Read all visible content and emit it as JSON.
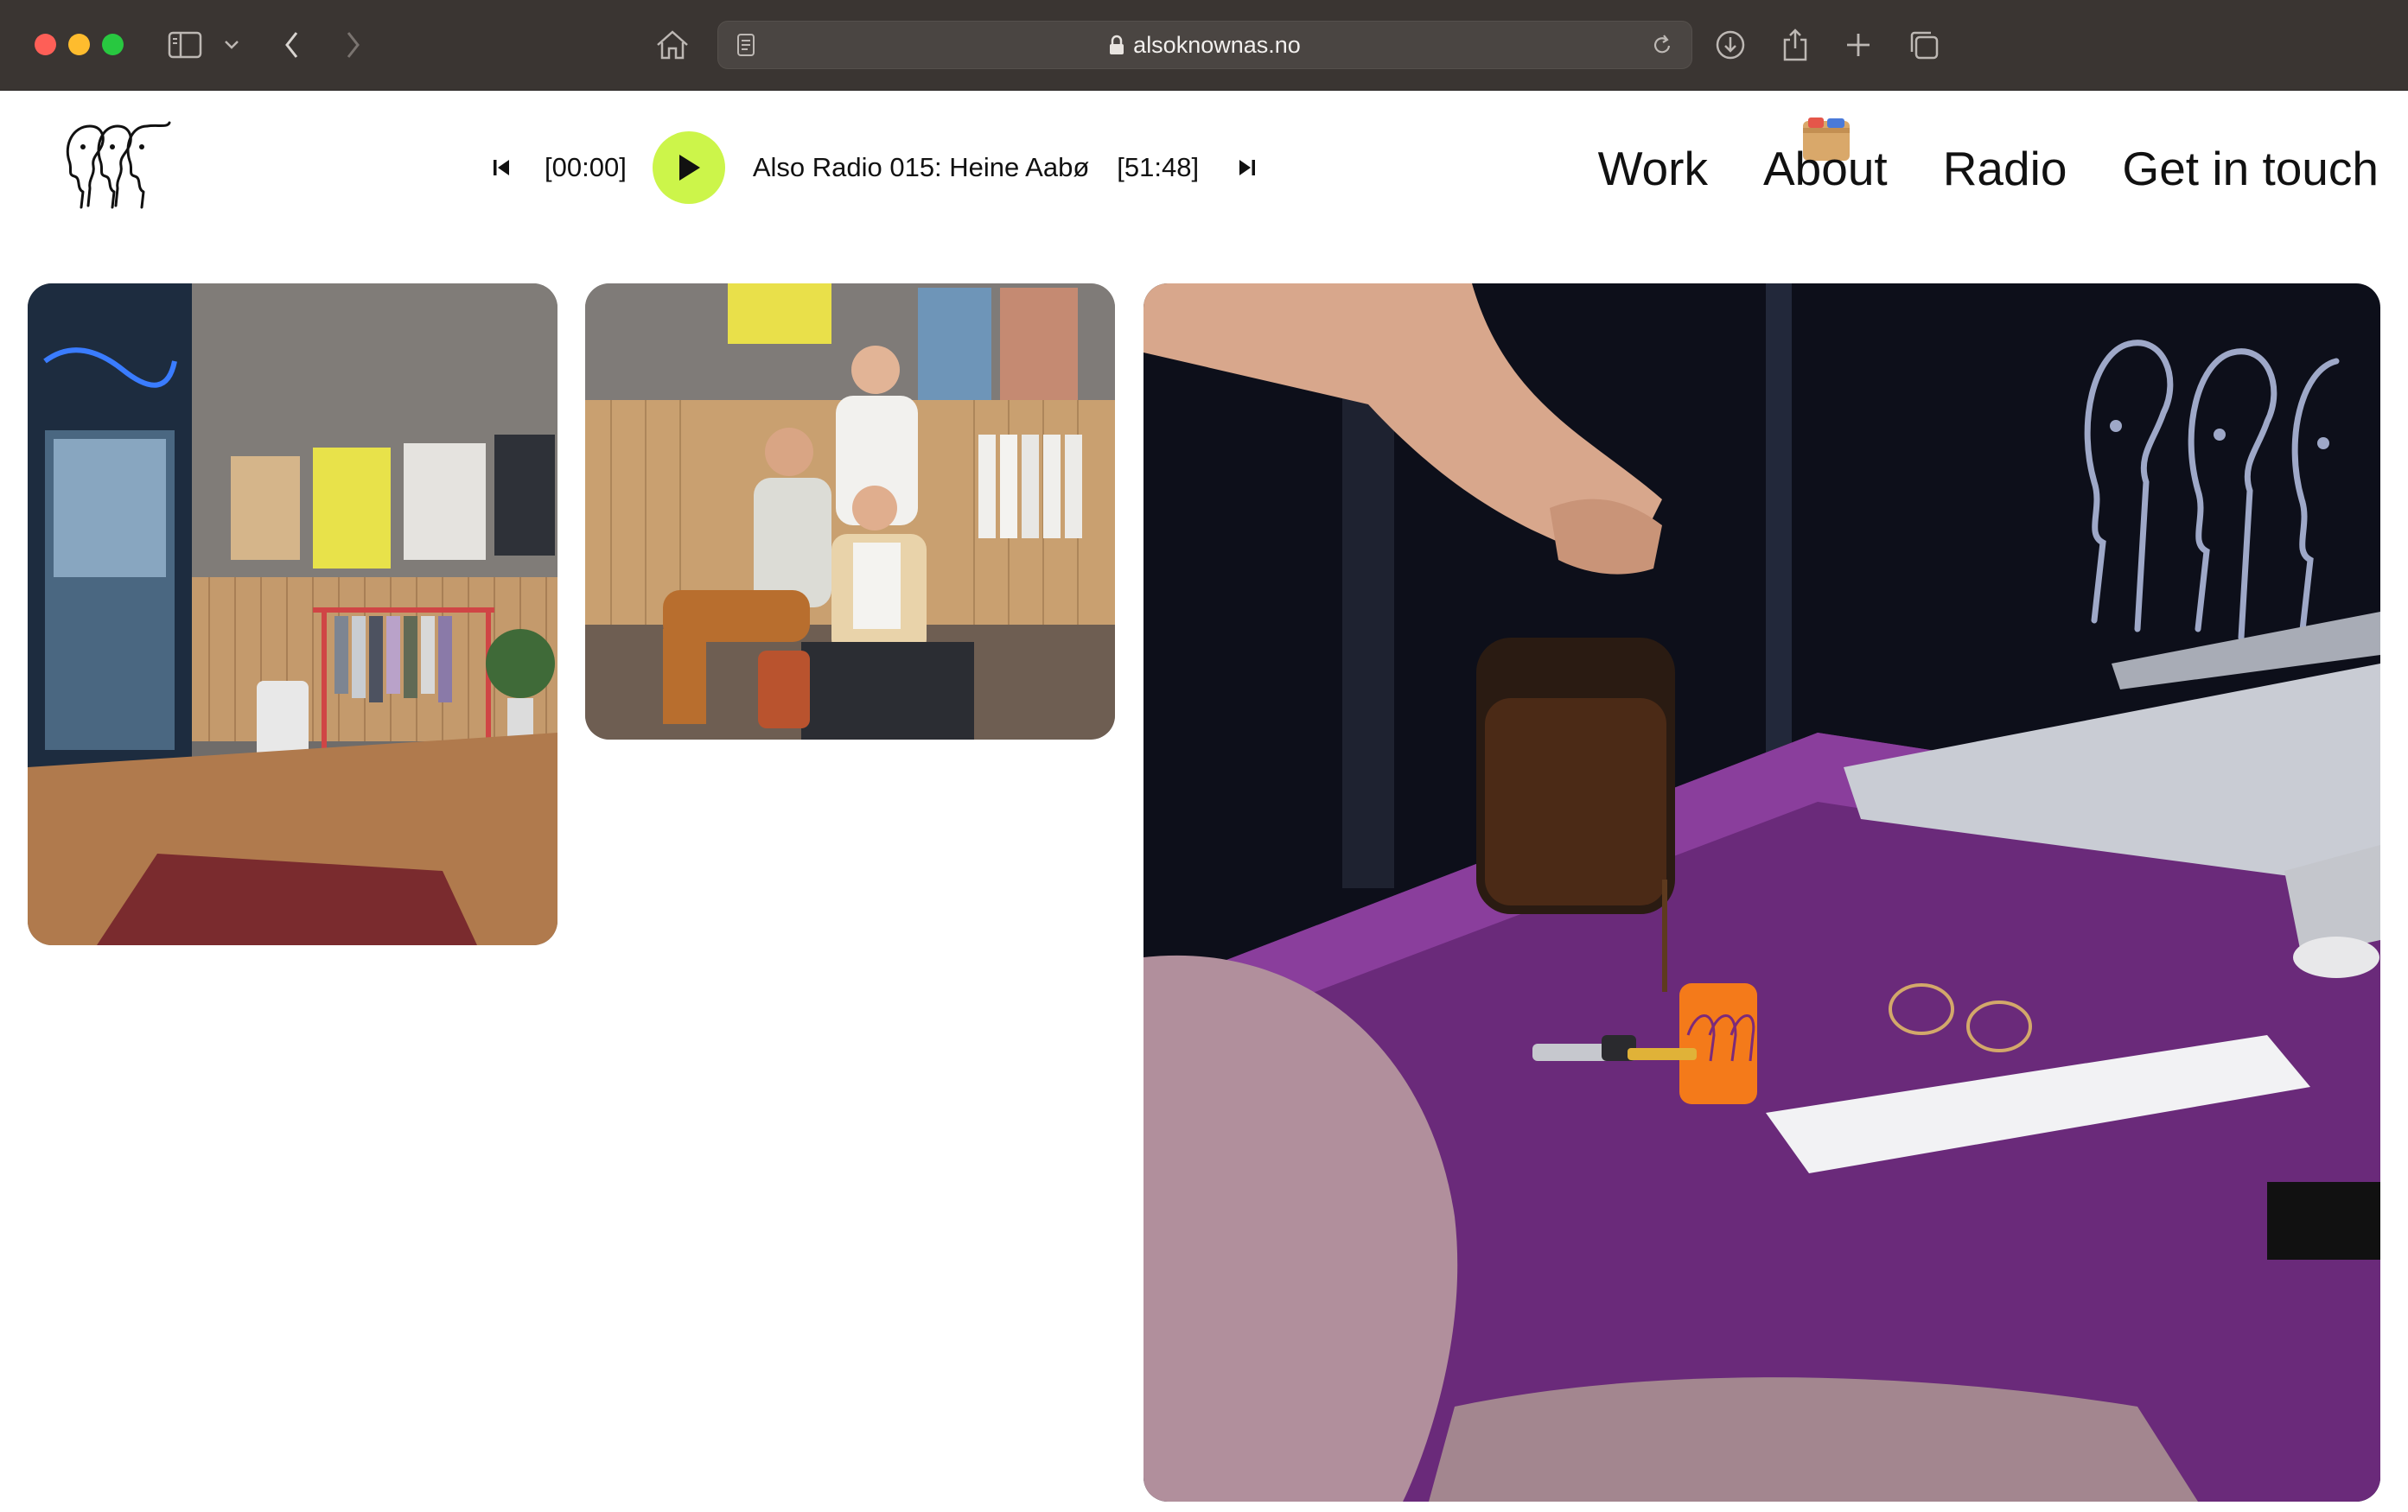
{
  "browser": {
    "url": "alsoknownas.no",
    "icons": [
      "sidebar-icon",
      "chevron-down-icon",
      "back-icon",
      "forward-icon",
      "home-icon",
      "reader-icon",
      "lock-icon",
      "reload-icon",
      "download-icon",
      "share-icon",
      "plus-icon",
      "tabs-icon"
    ]
  },
  "player": {
    "current_time": "[00:00]",
    "track_title": "Also Radio 015: Heine Aabø",
    "duration": "[51:48]",
    "accent_color": "#ccf54a"
  },
  "nav": {
    "items": [
      {
        "label": "Work"
      },
      {
        "label": "About"
      },
      {
        "label": "Radio"
      },
      {
        "label": "Get in touch"
      }
    ]
  },
  "gallery": {
    "photos": [
      {
        "name": "store-interior-photo"
      },
      {
        "name": "team-portrait-photo"
      },
      {
        "name": "coffee-desk-photo",
        "mug_text": "o Known As"
      }
    ]
  }
}
